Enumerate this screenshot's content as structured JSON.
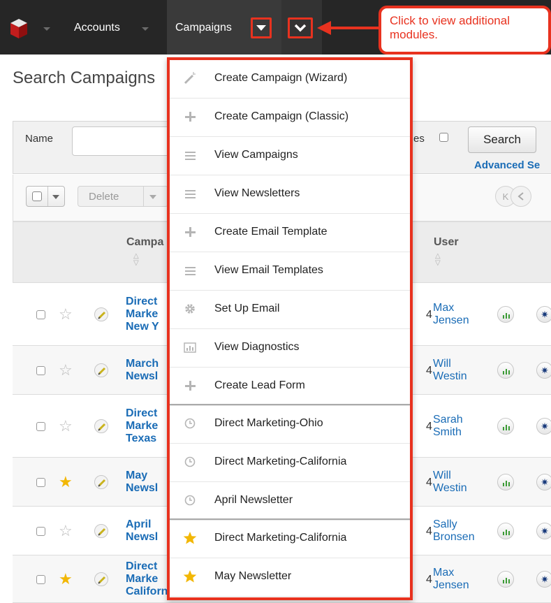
{
  "app": {
    "nav": {
      "accounts": "Accounts",
      "campaigns": "Campaigns",
      "callout": "Click to view additional modules."
    },
    "page_title": "Search Campaigns",
    "search": {
      "name_label": "Name",
      "name_value": "",
      "favorites_label": "es",
      "search_button": "Search",
      "advanced_link": "Advanced Se"
    },
    "actions": {
      "delete_label": "Delete",
      "pager_first": "K"
    },
    "columns": {
      "campaign": "Campa",
      "user": "User"
    },
    "rows": [
      {
        "name_lines": [
          "Direct",
          "Marke",
          "New Y"
        ],
        "user_lines": [
          "Max",
          "Jensen"
        ],
        "favorite": false,
        "digit": "4"
      },
      {
        "name_lines": [
          "March",
          "Newsl"
        ],
        "user_lines": [
          "Will",
          "Westin"
        ],
        "favorite": false,
        "digit": "4"
      },
      {
        "name_lines": [
          "Direct",
          "Marke",
          "Texas"
        ],
        "user_lines": [
          "Sarah",
          "Smith"
        ],
        "favorite": false,
        "digit": "4"
      },
      {
        "name_lines": [
          "May",
          "Newsl"
        ],
        "user_lines": [
          "Will",
          "Westin"
        ],
        "favorite": true,
        "digit": "4"
      },
      {
        "name_lines": [
          "April",
          "Newsl"
        ],
        "user_lines": [
          "Sally",
          "Bronsen"
        ],
        "favorite": false,
        "digit": "4"
      },
      {
        "name_lines": [
          "Direct",
          "Marke",
          "California"
        ],
        "user_lines": [
          "Max",
          "Jensen"
        ],
        "favorite": true,
        "digit": "4"
      }
    ],
    "menu": {
      "actions": [
        {
          "label": "Create Campaign (Wizard)",
          "icon": "magic-wand-icon"
        },
        {
          "label": "Create Campaign (Classic)",
          "icon": "plus-icon"
        },
        {
          "label": "View Campaigns",
          "icon": "list-icon"
        },
        {
          "label": "View Newsletters",
          "icon": "list-icon"
        },
        {
          "label": "Create Email Template",
          "icon": "plus-icon"
        },
        {
          "label": "View Email Templates",
          "icon": "list-icon"
        },
        {
          "label": "Set Up Email",
          "icon": "gear-icon"
        },
        {
          "label": "View Diagnostics",
          "icon": "bar-chart-icon"
        },
        {
          "label": "Create Lead Form",
          "icon": "plus-icon"
        }
      ],
      "recent": [
        {
          "label": "Direct Marketing-Ohio",
          "icon": "clock-icon"
        },
        {
          "label": "Direct Marketing-California",
          "icon": "clock-icon"
        },
        {
          "label": "April Newsletter",
          "icon": "clock-icon"
        }
      ],
      "favorites": [
        {
          "label": "Direct Marketing-California",
          "icon": "star-icon"
        },
        {
          "label": "May Newsletter",
          "icon": "star-icon"
        }
      ]
    },
    "colors": {
      "navbar": "#262626",
      "highlight": "#e8321f",
      "link": "#1a6cb6",
      "favorite_star": "#f2b705"
    }
  }
}
